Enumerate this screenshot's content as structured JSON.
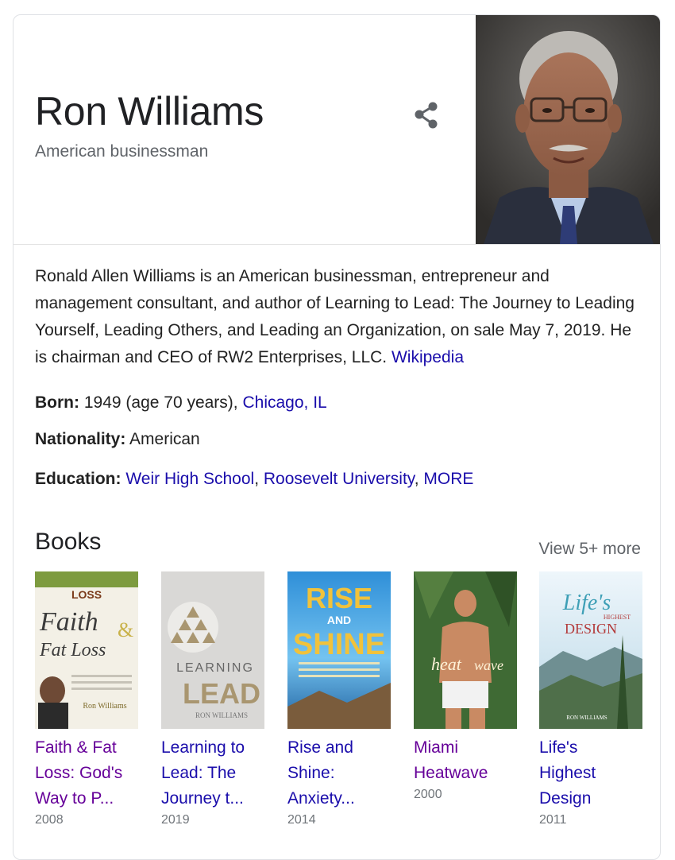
{
  "entity": {
    "name": "Ron Williams",
    "subtitle": "American businessman"
  },
  "description": {
    "text": "Ronald Allen Williams is an American businessman, entrepreneur and management consultant, and author of Learning to Lead: The Journey to Leading Yourself, Leading Others, and Leading an Organization, on sale May 7, 2019. He is chairman and CEO of RW2 Enterprises, LLC.",
    "source_link": "Wikipedia"
  },
  "facts": {
    "born": {
      "label": "Born:",
      "value": "1949 (age 70 years),",
      "link": "Chicago, IL"
    },
    "nationality": {
      "label": "Nationality:",
      "value": "American"
    },
    "education": {
      "label": "Education:",
      "links": [
        "Weir High School",
        "Roosevelt University",
        "MORE"
      ]
    }
  },
  "books": {
    "heading": "Books",
    "view_more": "View 5+ more",
    "items": [
      {
        "title_lines": [
          "Faith & Fat",
          "Loss: God's",
          "Way to P..."
        ],
        "year": "2008",
        "visited": true,
        "cover_text": [
          "LOSS",
          "Faith",
          "Fat Loss",
          "Ron Williams"
        ]
      },
      {
        "title_lines": [
          "Learning to",
          "Lead: The",
          "Journey t..."
        ],
        "year": "2019",
        "visited": false,
        "cover_text": [
          "LEARNING",
          "LEAD",
          "RON WILLIAMS"
        ]
      },
      {
        "title_lines": [
          "Rise and",
          "Shine:",
          "Anxiety..."
        ],
        "year": "2014",
        "visited": false,
        "cover_text": [
          "RISE",
          "AND",
          "SHINE"
        ]
      },
      {
        "title_lines": [
          "Miami",
          "Heatwave"
        ],
        "year": "2000",
        "visited": true,
        "cover_text": [
          "heat",
          "wave"
        ]
      },
      {
        "title_lines": [
          "Life's",
          "Highest",
          "Design"
        ],
        "year": "2011",
        "visited": false,
        "cover_text": [
          "Life's",
          "HIGHEST",
          "DESIGN",
          "RON WILLIAMS"
        ]
      }
    ]
  },
  "colors": {
    "link": "#1a0dab",
    "visited_link": "#660099",
    "muted": "#5f6368"
  },
  "icons": {
    "share": "share-icon"
  }
}
